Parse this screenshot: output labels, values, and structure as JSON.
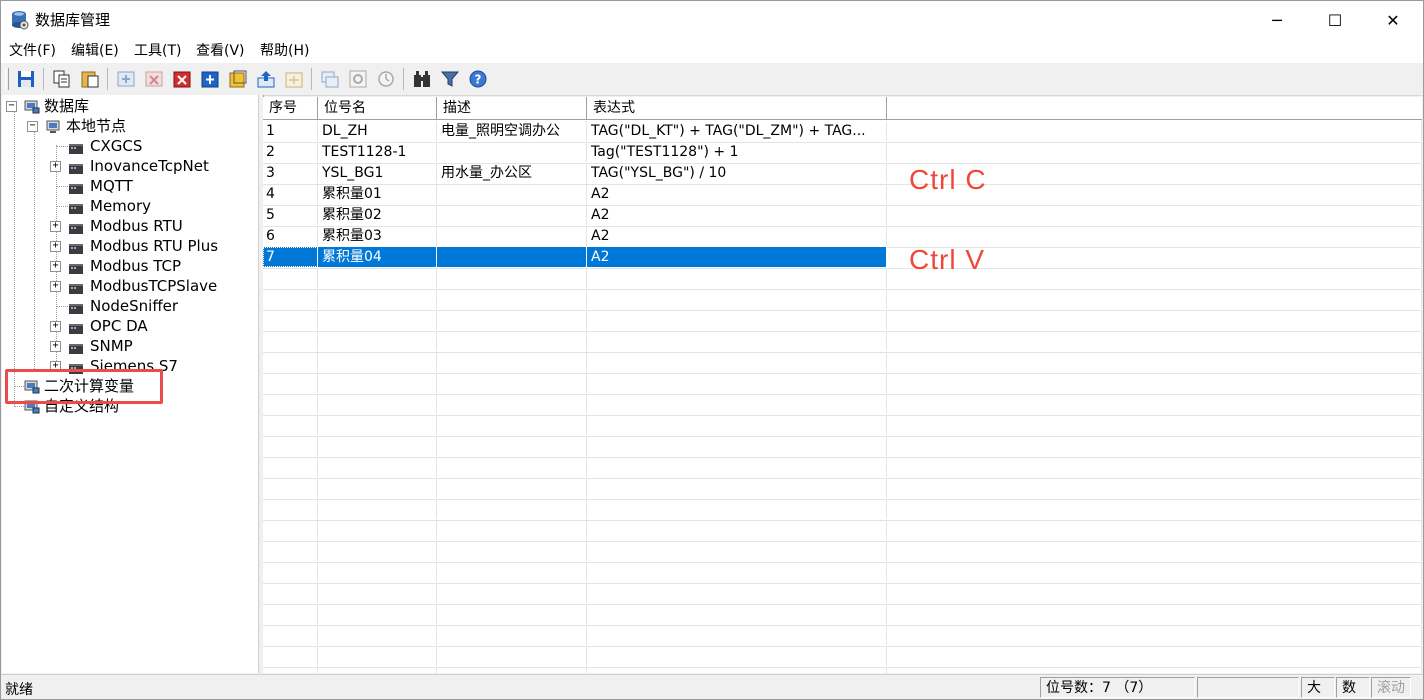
{
  "window": {
    "title": "数据库管理",
    "controls": {
      "minimize": "─",
      "maximize": "☐",
      "close": "✕"
    }
  },
  "menu": [
    "文件(F)",
    "编辑(E)",
    "工具(T)",
    "查看(V)",
    "帮助(H)"
  ],
  "toolbar_icons": [
    "save-icon",
    "copy-icon",
    "paste-icon",
    "add-row-icon",
    "delete-row-icon",
    "delete-red-icon",
    "add-blue-icon",
    "edit-yellow-icon",
    "import-icon",
    "export-icon",
    "window-icon",
    "refresh-icon",
    "history-icon",
    "find-icon",
    "filter-icon",
    "help-icon"
  ],
  "tree": {
    "root": "数据库",
    "local": "本地节点",
    "drivers": [
      "CXGCS",
      "InovanceTcpNet",
      "MQTT",
      "Memory",
      "Modbus RTU",
      "Modbus RTU Plus",
      "Modbus TCP",
      "ModbusTCPSlave",
      "NodeSniffer",
      "OPC DA",
      "SNMP",
      "Siemens S7"
    ],
    "calc": "二次计算变量",
    "custom": "自定义结构"
  },
  "grid": {
    "headers": [
      "序号",
      "位号名",
      "描述",
      "表达式"
    ],
    "rows": [
      {
        "no": "1",
        "name": "DL_ZH",
        "desc": "电量_照明空调办公",
        "expr": "TAG(\"DL_KT\") + TAG(\"DL_ZM\") + TAG..."
      },
      {
        "no": "2",
        "name": "TEST1128-1",
        "desc": "",
        "expr": "Tag(\"TEST1128\") + 1"
      },
      {
        "no": "3",
        "name": "YSL_BG1",
        "desc": "用水量_办公区",
        "expr": "TAG(\"YSL_BG\") / 10"
      },
      {
        "no": "4",
        "name": "累积量01",
        "desc": "",
        "expr": "A2"
      },
      {
        "no": "5",
        "name": "累积量02",
        "desc": "",
        "expr": "A2"
      },
      {
        "no": "6",
        "name": "累积量03",
        "desc": "",
        "expr": "A2"
      },
      {
        "no": "7",
        "name": "累积量04",
        "desc": "",
        "expr": "A2"
      }
    ],
    "selected_row": 6
  },
  "annotations": {
    "copy": "Ctrl  C",
    "paste": "Ctrl  V",
    "color": "#ef4836"
  },
  "status": {
    "left": "就绪",
    "count": "位号数：7  （7）",
    "caps": "大写",
    "num": "数字",
    "scroll": "滚动"
  },
  "colors": {
    "selection": "#0078d7",
    "highlight_box": "#ea4c4c"
  }
}
